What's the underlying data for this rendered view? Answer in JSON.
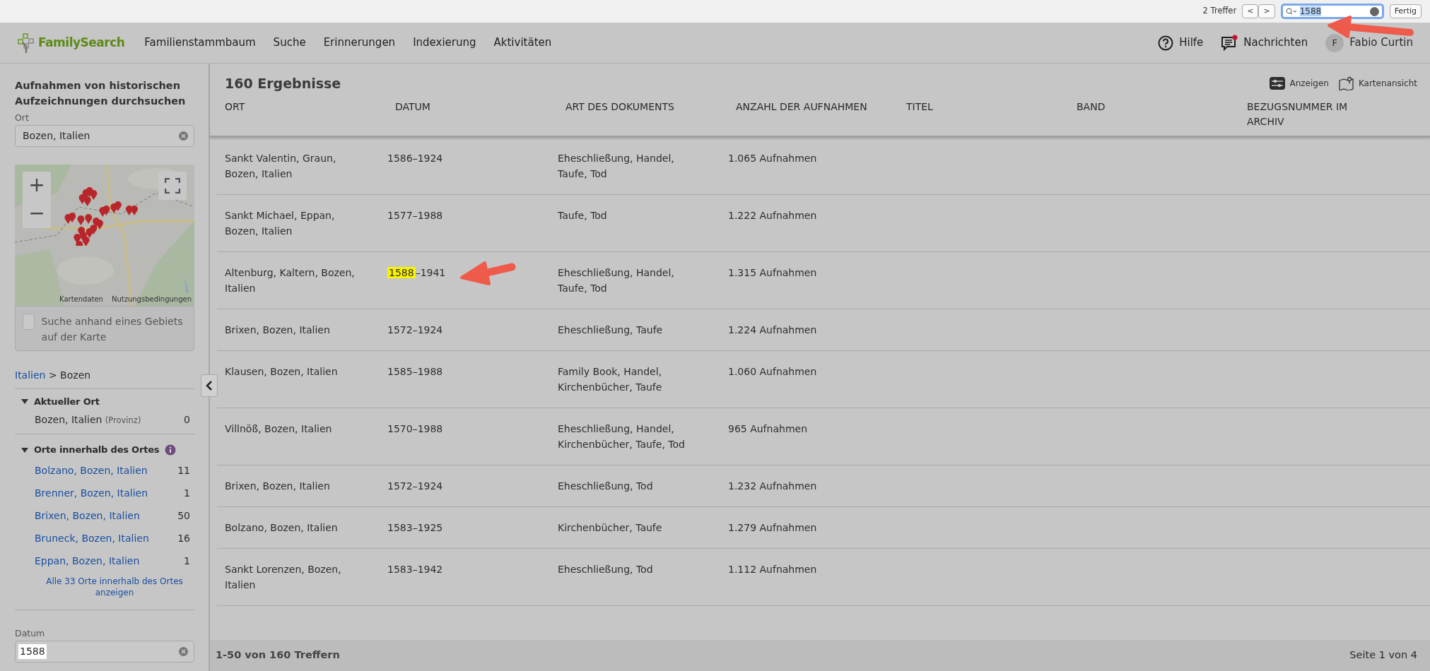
{
  "find_bar": {
    "match_count": "2 Treffer",
    "prev": "<",
    "next": ">",
    "query": "1588",
    "done": "Fertig"
  },
  "nav": {
    "logo": "FamilySearch",
    "items": [
      "Familienstammbaum",
      "Suche",
      "Erinnerungen",
      "Indexierung",
      "Aktivitäten"
    ],
    "help": "Hilfe",
    "messages": "Nachrichten",
    "messages_unread": true,
    "avatar": "F",
    "user": "Fabio Curtin"
  },
  "sidebar": {
    "title": "Aufnahmen von historischen Aufzeichnungen durchsuchen",
    "place_label": "Ort",
    "place_value": "Bozen, Italien",
    "map": {
      "zoom_in": "+",
      "zoom_out": "−",
      "data_link": "Kartendaten",
      "terms": "Nutzungsbedingungen"
    },
    "map_search": {
      "label": "Suche anhand eines Gebiets auf der Karte",
      "checked": false
    },
    "breadcrumb": {
      "parent": "Italien",
      "separator": ">",
      "current": "Bozen"
    },
    "current_place": {
      "heading": "Aktueller Ort",
      "expanded": true,
      "name": "Bozen, Italien",
      "type": "(Provinz)",
      "count": "0"
    },
    "sub_places": {
      "heading": "Orte innerhalb des Ortes",
      "expanded": true,
      "items": [
        {
          "name": "Bolzano, Bozen, Italien",
          "count": "11"
        },
        {
          "name": "Brenner, Bozen, Italien",
          "count": "1"
        },
        {
          "name": "Brixen, Bozen, Italien",
          "count": "50"
        },
        {
          "name": "Bruneck, Bozen, Italien",
          "count": "16"
        },
        {
          "name": "Eppan, Bozen, Italien",
          "count": "1"
        }
      ],
      "show_all": "Alle 33 Orte innerhalb des Ortes anzeigen"
    },
    "date_label": "Datum",
    "date_value": "1588"
  },
  "results": {
    "title": "160 Ergebnisse",
    "actions": [
      "Anzeigen",
      "Kartenansicht"
    ],
    "columns": [
      "ORT",
      "DATUM",
      "ART DES DOKUMENTS",
      "ANZAHL DER AUFNAHMEN",
      "TITEL",
      "BAND",
      "BEZUGSNUMMER IM ARCHIV"
    ],
    "rows": [
      {
        "ort": "Sankt Valentin, Graun, Bozen, Italien",
        "datum": [
          {
            "text": "1586–1924",
            "highlighted": false
          }
        ],
        "art": "Eheschließung, Handel, Taufe, Tod",
        "anzahl": "1.065 Aufnahmen"
      },
      {
        "ort": "Sankt Michael, Eppan, Bozen, Italien",
        "datum": [
          {
            "text": "1577–1988",
            "highlighted": false
          }
        ],
        "art": "Taufe, Tod",
        "anzahl": "1.222 Aufnahmen"
      },
      {
        "ort": "Altenburg, Kaltern, Bozen, Italien",
        "datum": [
          {
            "text": "1588",
            "highlighted": true
          },
          {
            "text": "–1941",
            "highlighted": false
          }
        ],
        "art": "Eheschließung, Handel, Taufe, Tod",
        "anzahl": "1.315 Aufnahmen"
      },
      {
        "ort": "Brixen, Bozen, Italien",
        "datum": [
          {
            "text": "1572–1924",
            "highlighted": false
          }
        ],
        "art": "Eheschließung, Taufe",
        "anzahl": "1.224 Aufnahmen"
      },
      {
        "ort": "Klausen, Bozen, Italien",
        "datum": [
          {
            "text": "1585–1988",
            "highlighted": false
          }
        ],
        "art": "Family Book, Handel, Kirchenbücher, Taufe",
        "anzahl": "1.060 Aufnahmen"
      },
      {
        "ort": "Villnöß, Bozen, Italien",
        "datum": [
          {
            "text": "1570–1988",
            "highlighted": false
          }
        ],
        "art": "Eheschließung, Handel, Kirchenbücher, Taufe, Tod",
        "anzahl": "965 Aufnahmen"
      },
      {
        "ort": "Brixen, Bozen, Italien",
        "datum": [
          {
            "text": "1572–1924",
            "highlighted": false
          }
        ],
        "art": "Eheschließung, Tod",
        "anzahl": "1.232 Aufnahmen"
      },
      {
        "ort": "Bolzano, Bozen, Italien",
        "datum": [
          {
            "text": "1583–1925",
            "highlighted": false
          }
        ],
        "art": "Kirchenbücher, Taufe",
        "anzahl": "1.279 Aufnahmen"
      },
      {
        "ort": "Sankt Lorenzen, Bozen, Italien",
        "datum": [
          {
            "text": "1583–1942",
            "highlighted": false
          }
        ],
        "art": "Eheschließung, Tod",
        "anzahl": "1.112 Aufnahmen"
      }
    ],
    "footer": {
      "range": "1-50 von 160 Treffern",
      "page": "Seite 1 von 4"
    }
  }
}
